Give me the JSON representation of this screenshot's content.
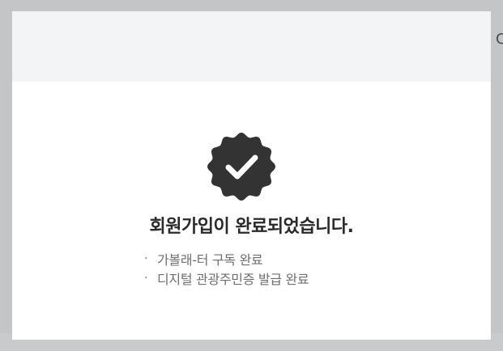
{
  "dialog": {
    "title": "회원가입이 완료되었습니다.",
    "items": [
      {
        "bullet": "·",
        "label": "가볼래-터 구독 완료"
      },
      {
        "bullet": "·",
        "label": "디지털 관광주민증 발급 완료"
      }
    ],
    "icon": "verified-check-badge-icon"
  },
  "colors": {
    "overlay": "#c4c5c7",
    "header_bg": "#f3f4f6",
    "badge": "#333333",
    "title_text": "#2a2a2a",
    "item_text": "#6f6f6f"
  }
}
